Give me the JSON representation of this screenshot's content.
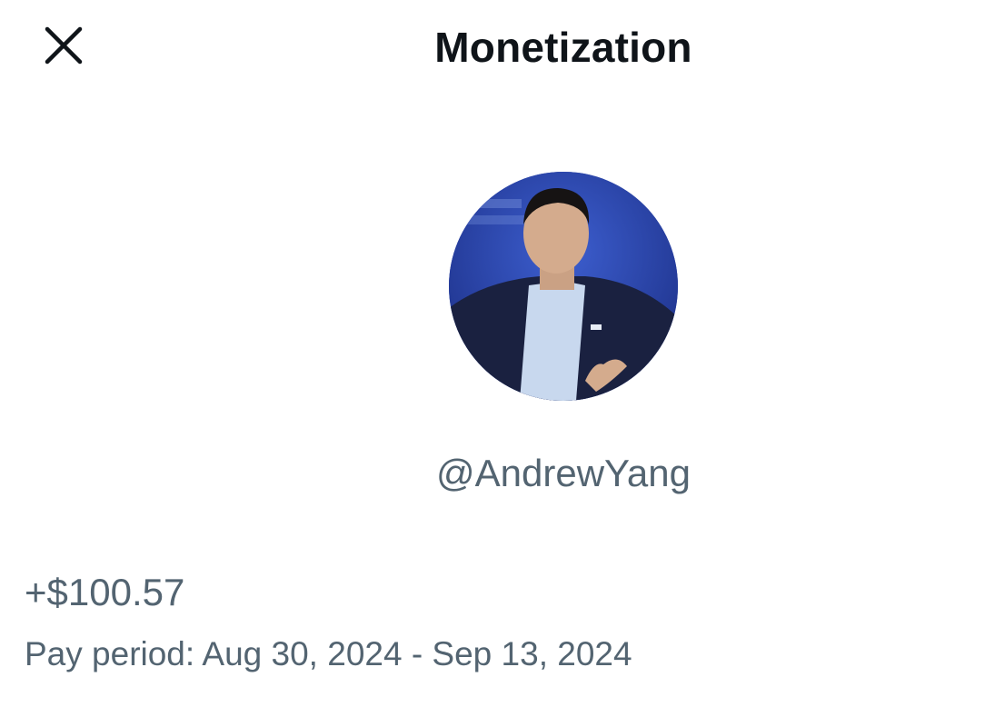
{
  "header": {
    "title": "Monetization",
    "close_icon": "close-icon"
  },
  "profile": {
    "handle": "@AndrewYang",
    "avatar_icon": "profile-photo"
  },
  "earnings": {
    "amount": "+$100.57",
    "pay_period": "Pay period: Aug 30, 2024 - Sep 13, 2024"
  },
  "colors": {
    "text_primary": "#0f1419",
    "text_secondary": "#536471",
    "background": "#ffffff"
  }
}
